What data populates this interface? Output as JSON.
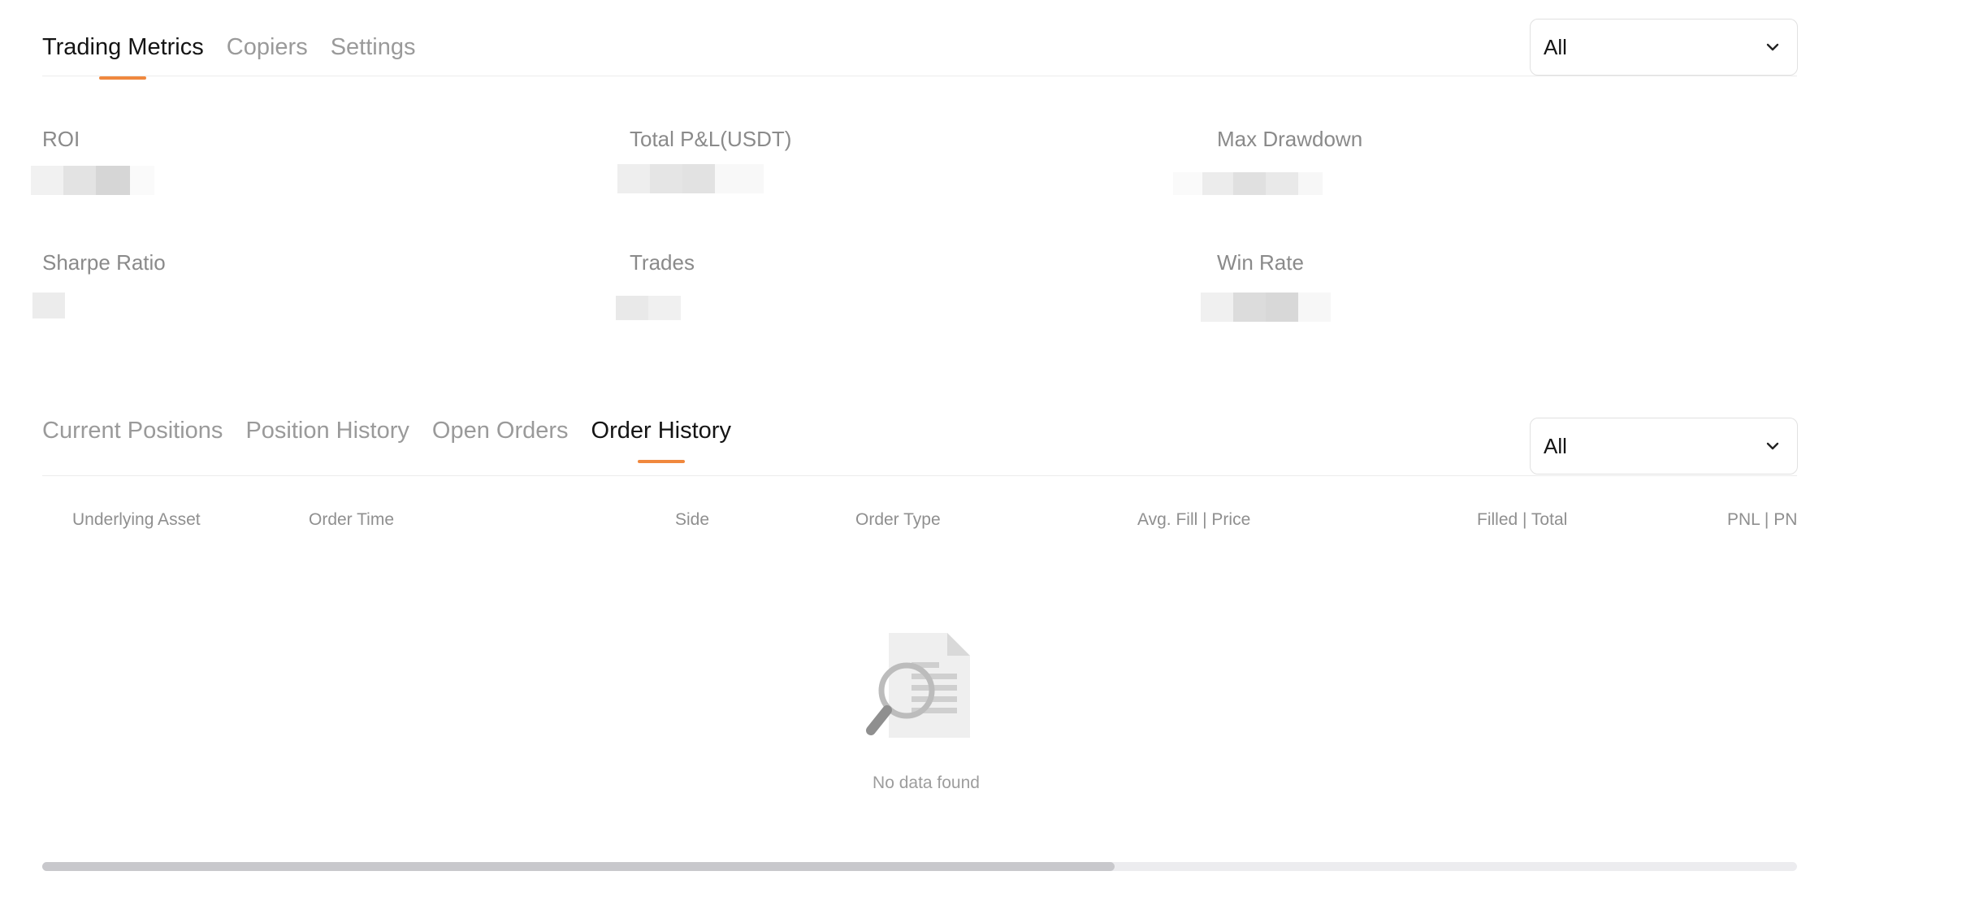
{
  "top_tabs": [
    {
      "label": "Trading Metrics",
      "active": true
    },
    {
      "label": "Copiers",
      "active": false
    },
    {
      "label": "Settings",
      "active": false
    }
  ],
  "top_filter": {
    "value": "All"
  },
  "metrics": {
    "roi": {
      "label": "ROI"
    },
    "total_pnl": {
      "label": "Total P&L(USDT)"
    },
    "max_drawdown": {
      "label": "Max Drawdown"
    },
    "sharpe_ratio": {
      "label": "Sharpe Ratio"
    },
    "trades": {
      "label": "Trades"
    },
    "win_rate": {
      "label": "Win Rate"
    }
  },
  "history_tabs": [
    {
      "label": "Current Positions",
      "active": false
    },
    {
      "label": "Position History",
      "active": false
    },
    {
      "label": "Open Orders",
      "active": false
    },
    {
      "label": "Order History",
      "active": true
    }
  ],
  "history_filter": {
    "value": "All"
  },
  "table": {
    "headers": [
      "Underlying Asset",
      "Order Time",
      "Side",
      "Order Type",
      "Avg. Fill | Price",
      "Filled | Total",
      "PNL | PNL"
    ]
  },
  "empty_state": {
    "text": "No data found",
    "icon": "magnifier-document-icon"
  },
  "colors": {
    "accent": "#f0883e",
    "active_text": "#141414",
    "muted_text": "#9a9a9a"
  },
  "scroll": {
    "position_fraction": 0.61
  }
}
